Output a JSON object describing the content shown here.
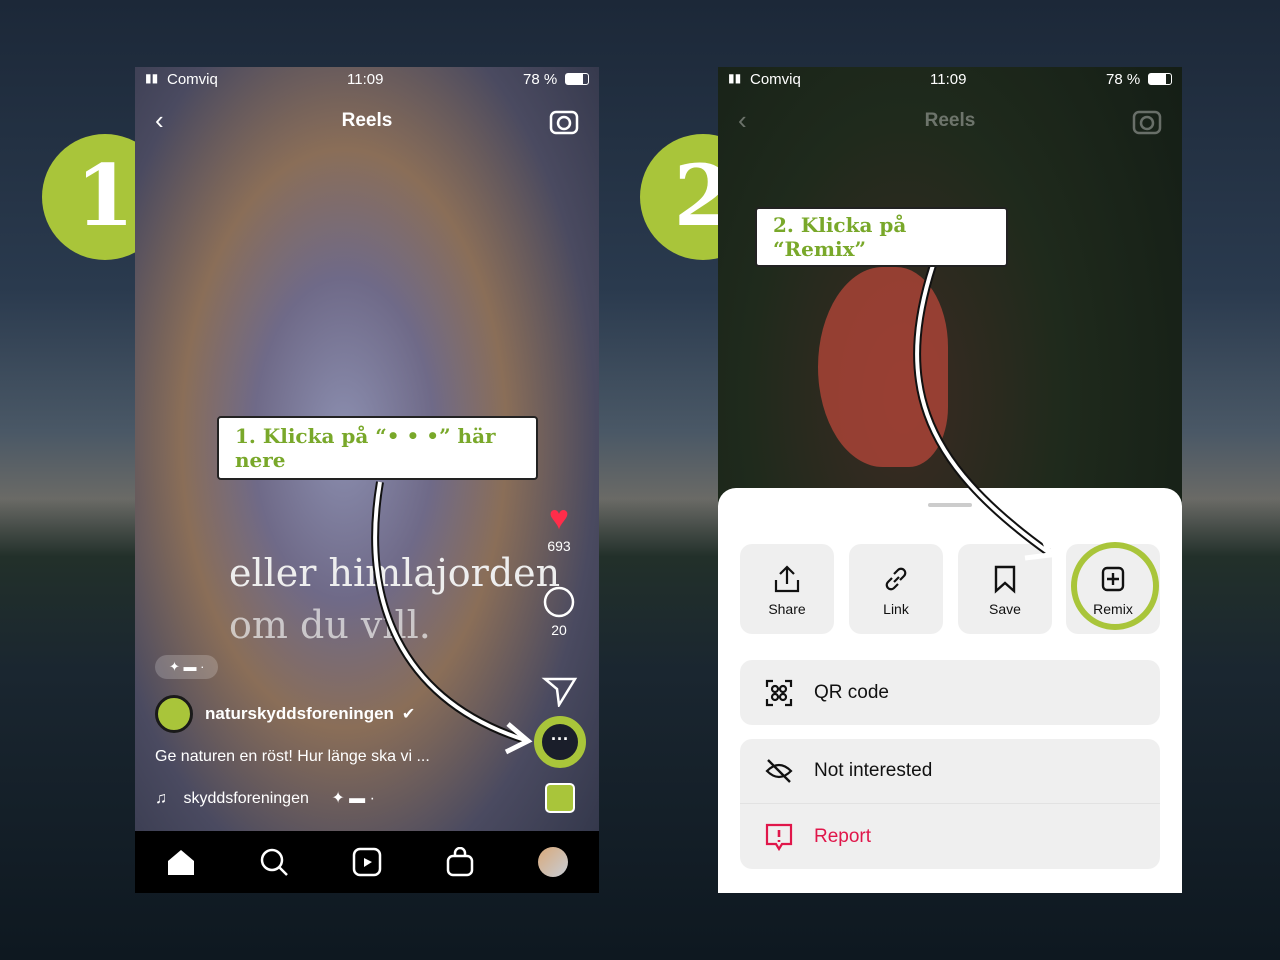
{
  "badges": [
    "1",
    "2"
  ],
  "callouts": {
    "step1": "1. Klicka på “• • •” här nere",
    "step2": "2. Klicka på “Remix”"
  },
  "colors": {
    "accent": "#a9c53a",
    "callout_text": "#79a82a",
    "report": "#e0164a"
  },
  "phone1": {
    "status": {
      "carrier": "Comviq",
      "time": "11:09",
      "battery": "78 %"
    },
    "header": {
      "title": "Reels"
    },
    "overlay_text": [
      "eller himlajorden",
      "om du vill."
    ],
    "likes": "693",
    "comments": "20",
    "username": "naturskyddsforeningen",
    "caption": "Ge naturen en röst! Hur länge ska vi ...",
    "audio": "skyddsforeningen",
    "nav": [
      "home-icon",
      "search-icon",
      "reels-icon",
      "shop-icon",
      "profile-avatar"
    ]
  },
  "phone2": {
    "status": {
      "carrier": "Comviq",
      "time": "11:09",
      "battery": "78 %"
    },
    "header": {
      "title": "Reels"
    },
    "tiles": [
      {
        "label": "Share",
        "icon": "share-icon"
      },
      {
        "label": "Link",
        "icon": "link-icon"
      },
      {
        "label": "Save",
        "icon": "bookmark-icon"
      },
      {
        "label": "Remix",
        "icon": "remix-icon"
      }
    ],
    "menu": {
      "qr": "QR code",
      "not_interested": "Not interested",
      "report": "Report"
    }
  }
}
